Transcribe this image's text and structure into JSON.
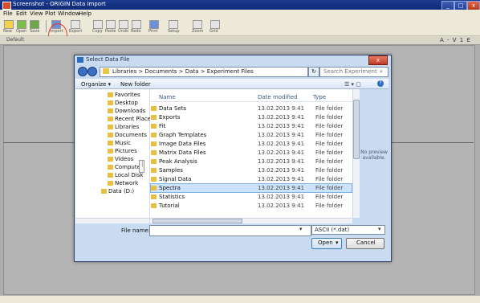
{
  "app": {
    "title": "Screenshot - ORIGIN Data Import",
    "window_buttons": {
      "minimize": "_",
      "maximize": "□",
      "close": "x"
    }
  },
  "menu": [
    "File",
    "Edit",
    "View",
    "Plot",
    "Window",
    "Help"
  ],
  "toolbar": {
    "buttons": [
      "New",
      "Open",
      "Save",
      "Import",
      "Export",
      "Copy",
      "Paste",
      "Undo",
      "Redo",
      "Print",
      "Setup",
      "Zoom",
      "Grid"
    ]
  },
  "subtoolbar": {
    "left": "Default",
    "right": "A - V 1 E"
  },
  "dialog": {
    "title": "Select Data File",
    "close": "x",
    "address": "Libraries > Documents > Data > Experiment Files",
    "refresh": "↻",
    "search_placeholder": "Search Experiment",
    "search_icon": "⌕",
    "organize": "Organize ▾",
    "new_folder": "New folder",
    "view_icons": "☰ ▾  ▢",
    "help": "?",
    "nav_items": [
      "Favorites",
      "Desktop",
      "Downloads",
      "Recent Places",
      "Libraries",
      "Documents",
      "Music",
      "Pictures",
      "Videos",
      "Computer",
      "Local Disk",
      "Network",
      "Data (D:)"
    ],
    "nav_splitter": "⋮",
    "columns": {
      "name": "Name",
      "date": "Date modified",
      "type": "Type"
    },
    "files": [
      {
        "name": "Data Sets",
        "date": "13.02.2013 9:41",
        "type": "File folder"
      },
      {
        "name": "Exports",
        "date": "13.02.2013 9:41",
        "type": "File folder"
      },
      {
        "name": "Fit",
        "date": "13.02.2013 9:41",
        "type": "File folder"
      },
      {
        "name": "Graph Templates",
        "date": "13.02.2013 9:41",
        "type": "File folder"
      },
      {
        "name": "Image Data Files",
        "date": "13.02.2013 9:41",
        "type": "File folder"
      },
      {
        "name": "Matrix Data Files",
        "date": "13.02.2013 9:41",
        "type": "File folder"
      },
      {
        "name": "Peak Analysis",
        "date": "13.02.2013 9:41",
        "type": "File folder"
      },
      {
        "name": "Samples",
        "date": "13.02.2013 9:41",
        "type": "File folder"
      },
      {
        "name": "Signal Data",
        "date": "13.02.2013 9:41",
        "type": "File folder"
      },
      {
        "name": "Spectra",
        "date": "13.02.2013 9:41",
        "type": "File folder"
      },
      {
        "name": "Statistics",
        "date": "13.02.2013 9:41",
        "type": "File folder"
      },
      {
        "name": "Tutorial",
        "date": "13.02.2013 9:41",
        "type": "File folder"
      }
    ],
    "selected_index": 9,
    "preview_message": "No preview available.",
    "filename_label": "File name:",
    "filename_value": "",
    "dropdown_arrow": "▾",
    "filter": "ASCII (*.dat)",
    "open": "Open",
    "cancel": "Cancel"
  }
}
